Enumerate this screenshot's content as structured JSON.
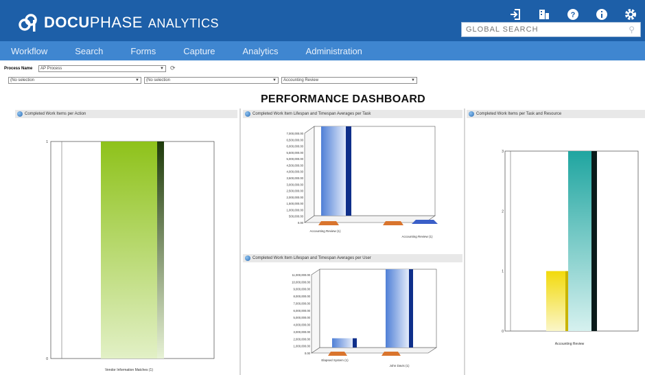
{
  "header": {
    "logo_bold": "DOCU",
    "logo_thin": "PHASE",
    "logo_suffix": "ANALYTICS",
    "icons": [
      "sign-out-icon",
      "building-icon",
      "help-icon",
      "info-icon",
      "gear-icon"
    ],
    "search_placeholder": "GLOBAL SEARCH",
    "colors": {
      "header_bg": "#1d5fa8",
      "nav_bg": "#3f86d0"
    }
  },
  "nav": {
    "items": [
      {
        "label": "Workflow"
      },
      {
        "label": "Search"
      },
      {
        "label": "Forms"
      },
      {
        "label": "Capture"
      },
      {
        "label": "Analytics"
      },
      {
        "label": "Administration"
      }
    ]
  },
  "filters": {
    "process_label": "Process Name",
    "process_value": "AP Process",
    "filter1_value": "(No selection",
    "filter2_value": "(No selection",
    "filter3_value": "Accounting Review"
  },
  "dashboard": {
    "title": "PERFORMANCE DASHBOARD"
  },
  "panels": {
    "left_title": "Completed Work Items per Action",
    "mid_top_title": "Completed Work Item Lifespan and Timespan Averages per Task",
    "mid_bottom_title": "Completed Work Item Lifespan and Timespan Averages per User",
    "right_title": "Completed Work Items per Task and Resource"
  },
  "chart_data": [
    {
      "type": "bar",
      "categories": [
        "Vendor Information Matches (1)"
      ],
      "values": [
        1
      ],
      "ylim": [
        0,
        1
      ],
      "yticks": [
        "0",
        "1"
      ],
      "colors": [
        "#8ec21a"
      ]
    },
    {
      "type": "bar",
      "categories": [
        "Accounting Review (1)",
        "Accounting Review (1)"
      ],
      "series": [
        {
          "values": [
            7000000,
            0
          ],
          "color": "#4f7fd6"
        },
        {
          "values": [
            0,
            0
          ],
          "color": "#d9742d"
        }
      ],
      "yticks": [
        "0.00",
        "500,000.00",
        "1,000,000.00",
        "1,500,000.00",
        "2,000,000.00",
        "2,500,000.00",
        "3,000,000.00",
        "3,500,000.00",
        "4,000,000.00",
        "4,500,000.00",
        "5,000,000.00",
        "5,500,000.00",
        "6,000,000.00",
        "6,500,000.00",
        "7,000,000.00"
      ],
      "ylim": [
        0,
        7000000
      ]
    },
    {
      "type": "bar",
      "categories": [
        "Elapsed System (1)",
        "John Davis (1)"
      ],
      "series": [
        {
          "values": [
            1300000,
            11000000
          ],
          "color": "#4f7fd6"
        },
        {
          "values": [
            0,
            0
          ],
          "color": "#d9742d"
        }
      ],
      "yticks": [
        "0.00",
        "1,000,000.00",
        "2,000,000.00",
        "3,000,000.00",
        "4,000,000.00",
        "5,000,000.00",
        "6,000,000.00",
        "7,000,000.00",
        "8,000,000.00",
        "9,000,000.00",
        "10,000,000.00",
        "11,000,000.00"
      ],
      "ylim": [
        0,
        11000000
      ]
    },
    {
      "type": "bar",
      "categories": [
        "Accounting Review"
      ],
      "series": [
        {
          "values": [
            1
          ],
          "color": "#f2da0c"
        },
        {
          "values": [
            3
          ],
          "color": "#1fa5a0"
        }
      ],
      "yticks": [
        "0",
        "1",
        "2",
        "3"
      ],
      "ylim": [
        0,
        3
      ]
    }
  ]
}
